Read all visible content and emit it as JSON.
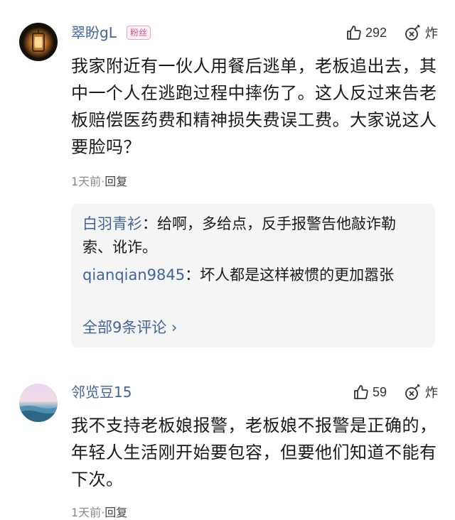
{
  "comments": [
    {
      "username": "翠盼gL",
      "badge": "粉丝",
      "likes": "292",
      "bomb_label": "炸",
      "text": "我家附近有一伙人用餐后逃单，老板追出去，其中一个人在逃跑过程中摔伤了。这人反过来告老板赔偿医药费和精神损失费误工费。大家说这人要脸吗？",
      "time": "1天前",
      "separator": "·",
      "reply_label": "回复",
      "replies": [
        {
          "author": "白羽青衫",
          "colon": "：",
          "text": "给啊，多给点，反手报警告他敲诈勒索、讹诈。"
        },
        {
          "author": "qianqian9845",
          "colon": "：",
          "text": "坏人都是这样被惯的更加嚣张"
        }
      ],
      "view_all": "全部9条评论 ›"
    },
    {
      "username": "邻览豆15",
      "likes": "59",
      "bomb_label": "炸",
      "text": "我不支持老板娘报警，老板娘不报警是正确的，年轻人生活刚开始要包容，但要他们知道不能有下次。",
      "time": "1天前",
      "separator": "·",
      "reply_label": "回复"
    }
  ],
  "icons": {
    "like": "thumbs-up-outline",
    "bomb": "bomb-outline"
  },
  "colors": {
    "username": "#406599",
    "badge": "#d4508a",
    "reply_box_bg": "#f5f5f5",
    "meta": "#8a8a8a"
  }
}
